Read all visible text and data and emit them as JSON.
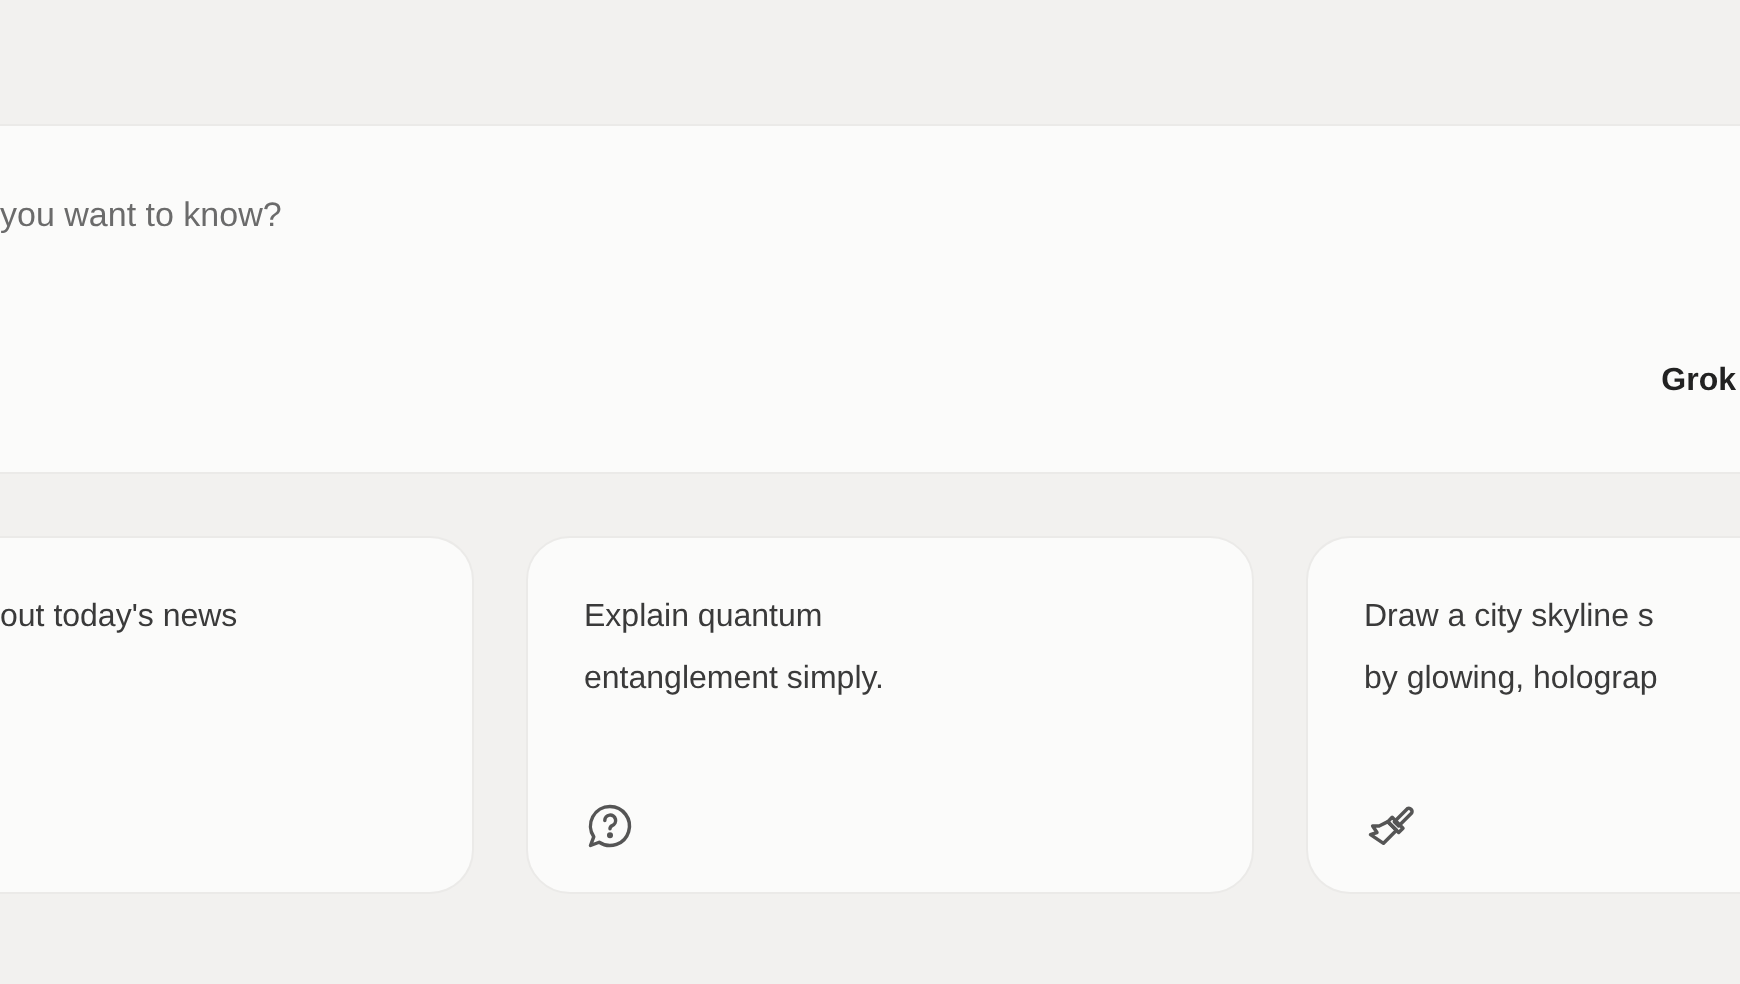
{
  "prompt": {
    "placeholder": "you want to know?",
    "model": "Grok"
  },
  "suggestions": [
    {
      "lines": [
        "out today's news"
      ],
      "kind": "plain"
    },
    {
      "lines": [
        "Explain quantum",
        "entanglement simply."
      ],
      "kind": "question"
    },
    {
      "lines": [
        "Draw a city skyline s",
        "by glowing, holograp"
      ],
      "kind": "image"
    }
  ]
}
